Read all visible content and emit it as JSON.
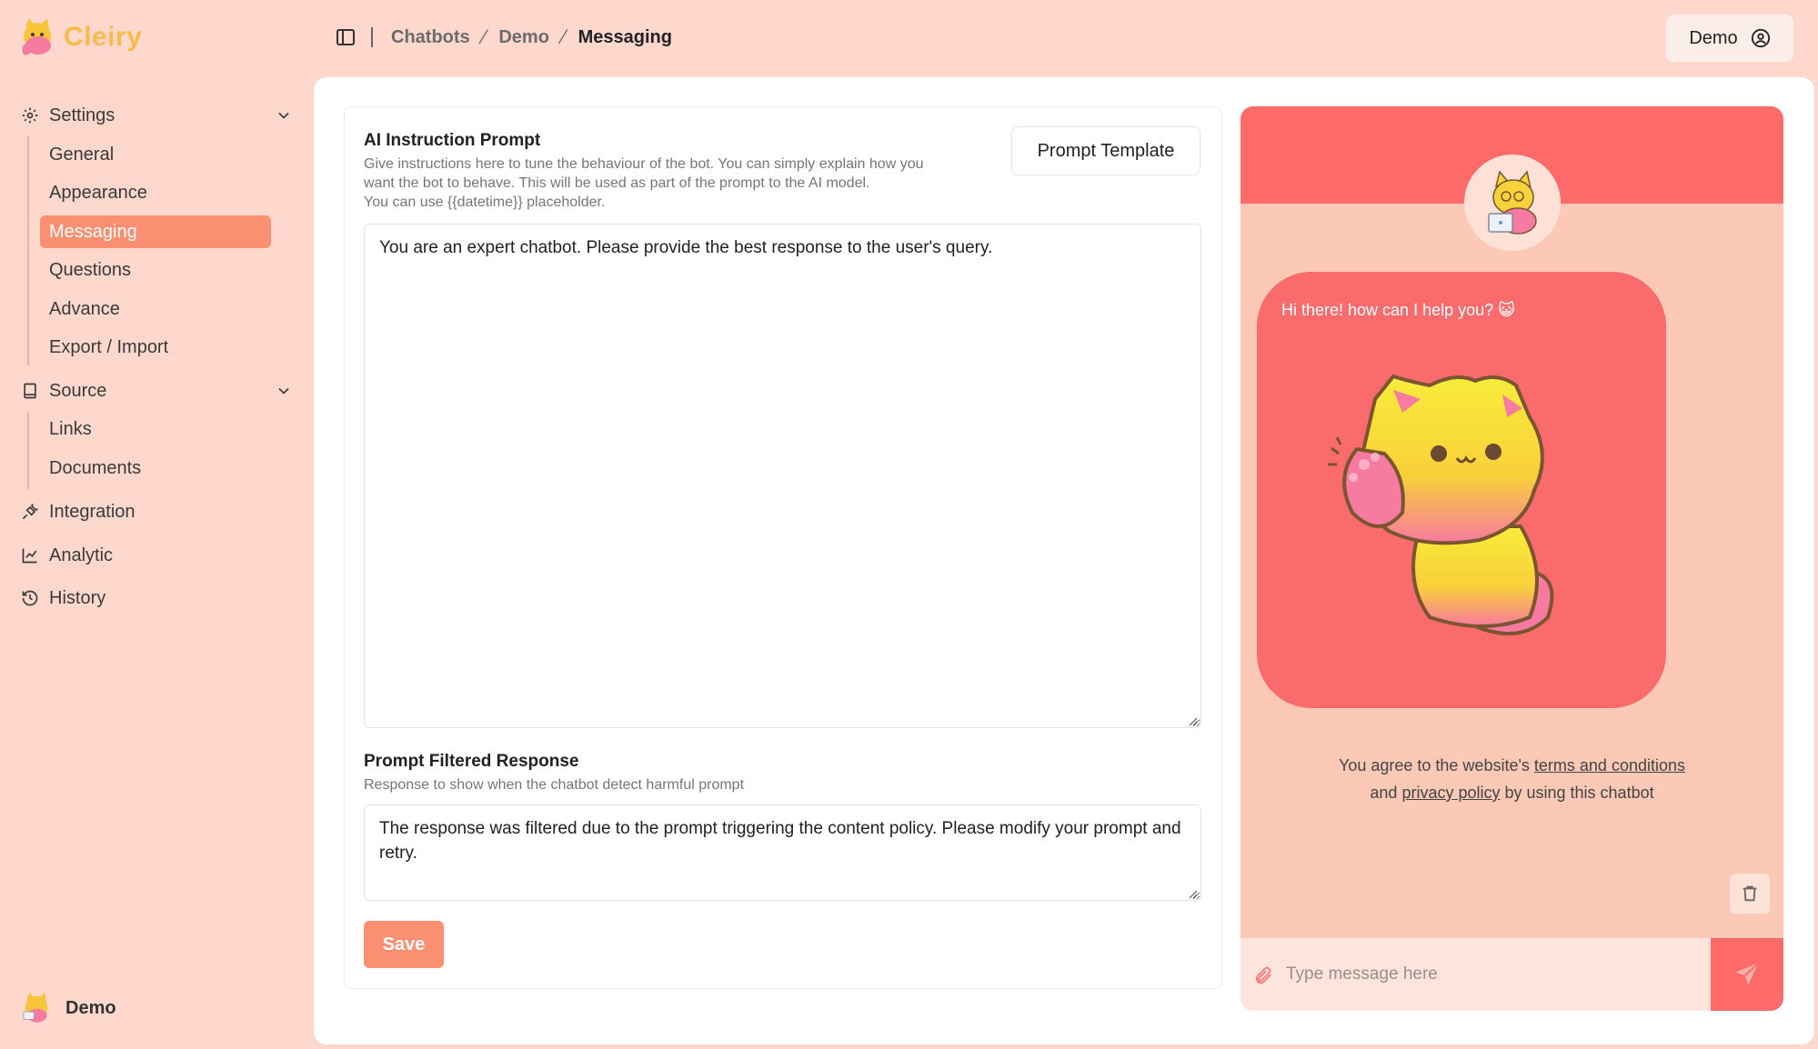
{
  "app": {
    "name": "Cleiry"
  },
  "sidebar": {
    "groups": [
      {
        "label": "Settings",
        "icon": "gear-icon",
        "items": [
          "General",
          "Appearance",
          "Messaging",
          "Questions",
          "Advance",
          "Export / Import"
        ],
        "active": "Messaging"
      },
      {
        "label": "Source",
        "icon": "book-icon",
        "items": [
          "Links",
          "Documents"
        ]
      }
    ],
    "links": [
      {
        "label": "Integration",
        "icon": "plug-icon"
      },
      {
        "label": "Analytic",
        "icon": "chart-icon"
      },
      {
        "label": "History",
        "icon": "history-icon"
      }
    ],
    "user_name": "Demo"
  },
  "header": {
    "breadcrumbs": [
      "Chatbots",
      "Demo",
      "Messaging"
    ],
    "user_button": "Demo"
  },
  "form": {
    "prompt_title": "AI Instruction Prompt",
    "prompt_help": [
      "Give instructions here to tune the behaviour of the bot. You can simply explain how you",
      "want the bot to behave. This will be used as part of the prompt to the AI model.",
      "You can use {{datetime}} placeholder."
    ],
    "template_button": "Prompt Template",
    "prompt_value": "You are an expert chatbot. Please provide the best response to the user's query.",
    "filtered_title": "Prompt Filtered Response",
    "filtered_help": "Response to show when the chatbot detect harmful prompt",
    "filtered_value": "The response was filtered due to the prompt triggering the content policy. Please modify your prompt and retry.",
    "save_button": "Save"
  },
  "chat": {
    "greeting": "Hi there! how can I help you? 😺",
    "terms_prefix": "You agree to the website's ",
    "terms_link": "terms and conditions",
    "terms_and": "and ",
    "privacy_link": "privacy policy",
    "terms_suffix": " by using this chatbot",
    "input_placeholder": "Type message here"
  },
  "colors": {
    "background": "#fed8cd",
    "accent": "#fa8f72",
    "chat_header": "#fd6a6a",
    "logo": "#f8ba4a"
  }
}
